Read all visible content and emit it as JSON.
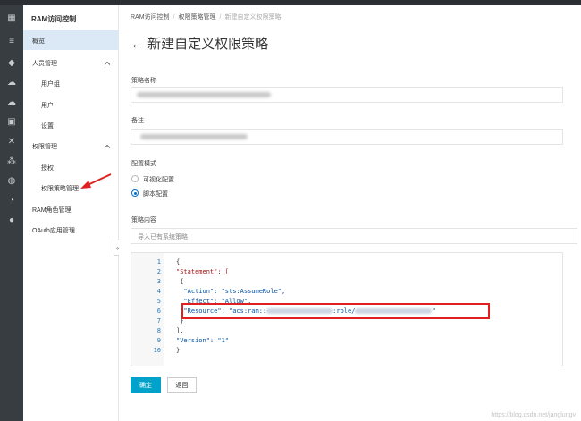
{
  "sidebar": {
    "title": "RAM访问控制",
    "items": [
      {
        "label": "概览",
        "active": true
      },
      {
        "label": "人员管理",
        "group": true
      },
      {
        "label": "用户组"
      },
      {
        "label": "用户"
      },
      {
        "label": "设置"
      },
      {
        "label": "权限管理",
        "group": true
      },
      {
        "label": "授权"
      },
      {
        "label": "权限策略管理"
      },
      {
        "label": "RAM角色管理"
      },
      {
        "label": "OAuth应用管理"
      }
    ],
    "collapse_glyph": "«"
  },
  "breadcrumb": {
    "items": [
      "RAM访问控制",
      "权限策略管理",
      "新建自定义权限策略"
    ],
    "separator": "/"
  },
  "page": {
    "back_glyph": "←",
    "title": "新建自定义权限策略"
  },
  "form": {
    "name_label": "策略名称",
    "note_label": "备注",
    "mode_label": "配置模式",
    "mode_options": [
      {
        "label": "可视化配置",
        "selected": false
      },
      {
        "label": "脚本配置",
        "selected": true
      }
    ],
    "content_label": "策略内容",
    "import_placeholder": "导入已有系统策略"
  },
  "editor": {
    "line_numbers": [
      "1",
      "2",
      "3",
      "4",
      "5",
      "6",
      "7",
      "8",
      "9",
      "10"
    ],
    "lines": [
      "{",
      "\"Statement\": [",
      " {",
      "  \"Action\": \"sts:AssumeRole\",",
      "  \"Effect\": \"Allow\",",
      "  \"Resource\": \"acs:ram::",
      " }",
      "],",
      "\"Version\": \"1\"",
      "}"
    ],
    "line6_mid": ":role/",
    "line6_end": "\""
  },
  "buttons": {
    "ok": "确定",
    "back": "返回"
  },
  "watermark": "https://blog.csdn.net/janglungv",
  "colors": {
    "accent": "#00a2ca",
    "highlight_box": "#e02020",
    "active_nav": "#dbe9f6"
  }
}
